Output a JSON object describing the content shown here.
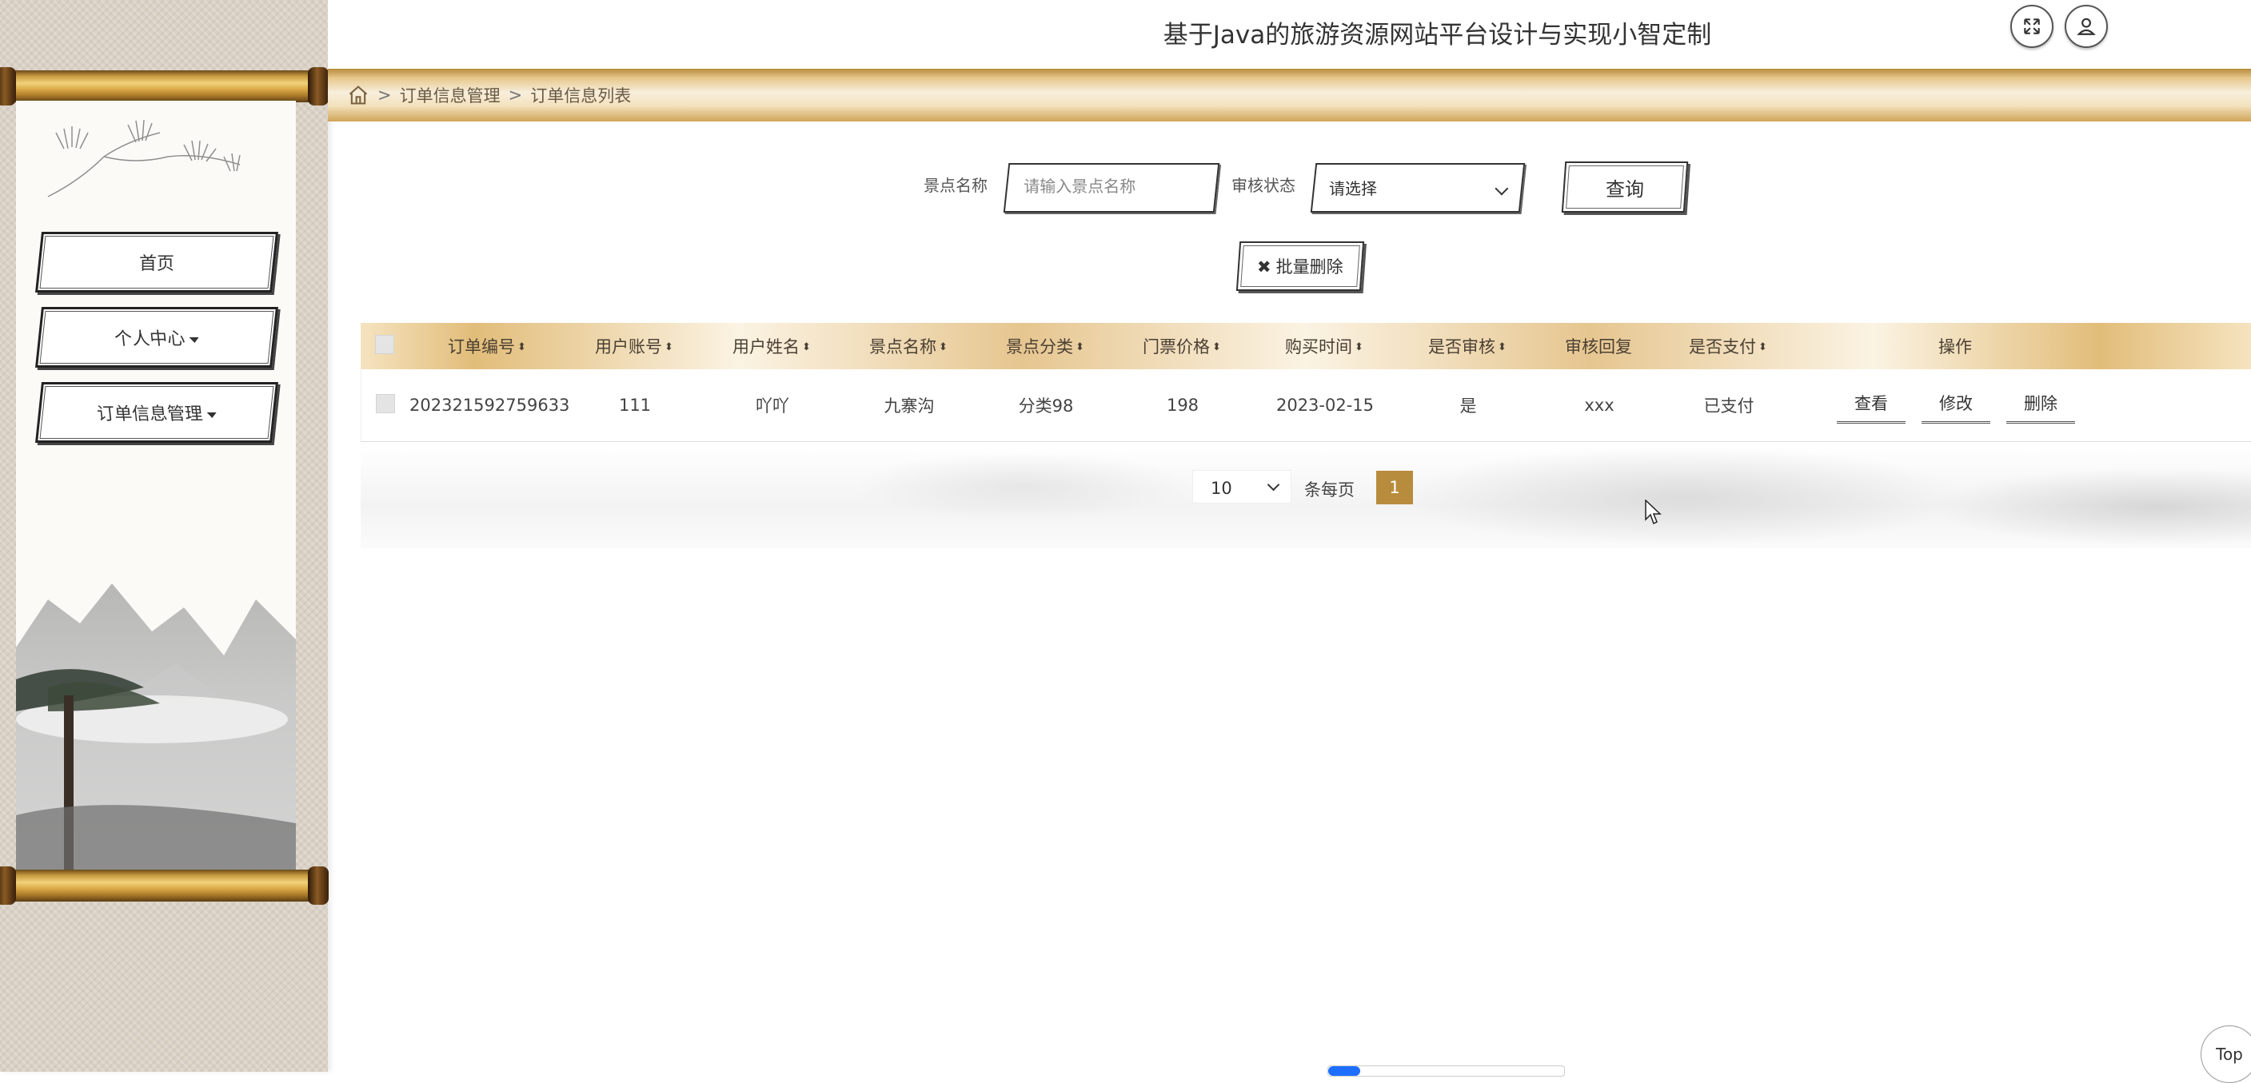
{
  "header": {
    "title": "基于Java的旅游资源网站平台设计与实现小智定制",
    "fullscreen_icon": "expand-icon",
    "user_icon": "user-icon"
  },
  "breadcrumb": {
    "home_icon": "home-icon",
    "separator": ">",
    "items": [
      "订单信息管理",
      "订单信息列表"
    ]
  },
  "sidebar": {
    "items": [
      {
        "label": "首页",
        "has_dropdown": false
      },
      {
        "label": "个人中心",
        "has_dropdown": true
      },
      {
        "label": "订单信息管理",
        "has_dropdown": true
      }
    ]
  },
  "search": {
    "name_label": "景点名称",
    "name_placeholder": "请输入景点名称",
    "status_label": "审核状态",
    "status_value": "请选择",
    "query_button": "查询",
    "batch_delete_button": "批量删除"
  },
  "table": {
    "columns": [
      "订单编号",
      "用户账号",
      "用户姓名",
      "景点名称",
      "景点分类",
      "门票价格",
      "购买时间",
      "是否审核",
      "审核回复",
      "是否支付",
      "操作"
    ],
    "rows": [
      {
        "order_no": "202321592759633",
        "account": "111",
        "user_name": "吖吖",
        "spot_name": "九寨沟",
        "category": "分类98",
        "price": "198",
        "buy_time": "2023-02-15",
        "audited": "是",
        "reply": "xxx",
        "paid": "已支付"
      }
    ],
    "actions": [
      "查看",
      "修改",
      "删除"
    ]
  },
  "pagination": {
    "page_size": "10",
    "per_page_label": "条每页",
    "current_page": "1"
  },
  "top_button": "Top",
  "colors": {
    "accent_gold": "#b88c3d",
    "header_band": "#e7c98d"
  }
}
